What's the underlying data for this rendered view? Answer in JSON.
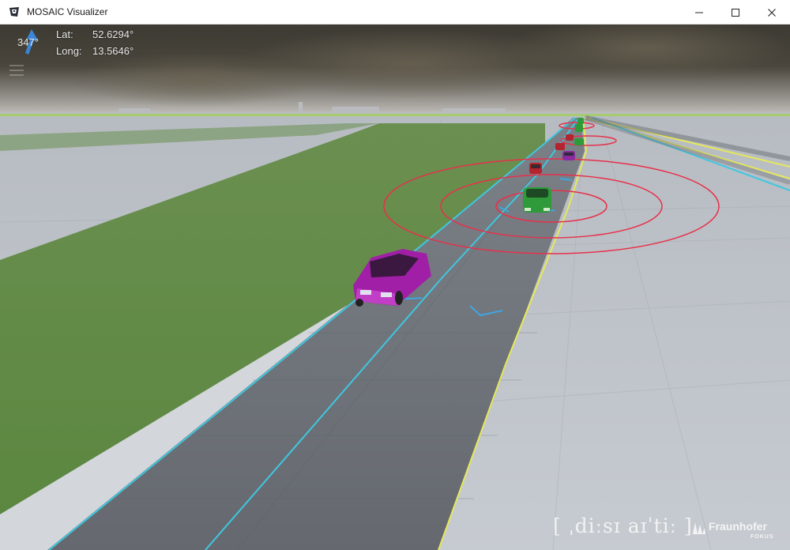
{
  "window": {
    "title": "MOSAIC Visualizer",
    "icons": {
      "app": "mosaic-app-icon",
      "minimize": "minimize-icon",
      "maximize": "maximize-icon",
      "close": "close-icon"
    }
  },
  "hud": {
    "heading": "347°",
    "lat_label": "Lat:",
    "lat_value": "52.6294°",
    "long_label": "Long:",
    "long_value": "13.5646°",
    "compass_icon": "north-arrow-icon",
    "menu_icon": "hamburger-menu-icon"
  },
  "branding": {
    "dissert": "[ ˌdiːsɪ aɪˈtiː ]",
    "fraunhofer": "Fraunhofer",
    "fokus": "FOKUS"
  },
  "colors": {
    "grass": "#5f8a45",
    "road": "#6e737b",
    "sidewalk": "#c9ced4",
    "lane_line": "#3fc7e0",
    "edge_line": "#e6e85a",
    "vehicle_focus": "#a01fa6",
    "vehicle_green": "#2e9a3a",
    "vehicle_red": "#b3242f",
    "range_circle": "#e8304a"
  }
}
